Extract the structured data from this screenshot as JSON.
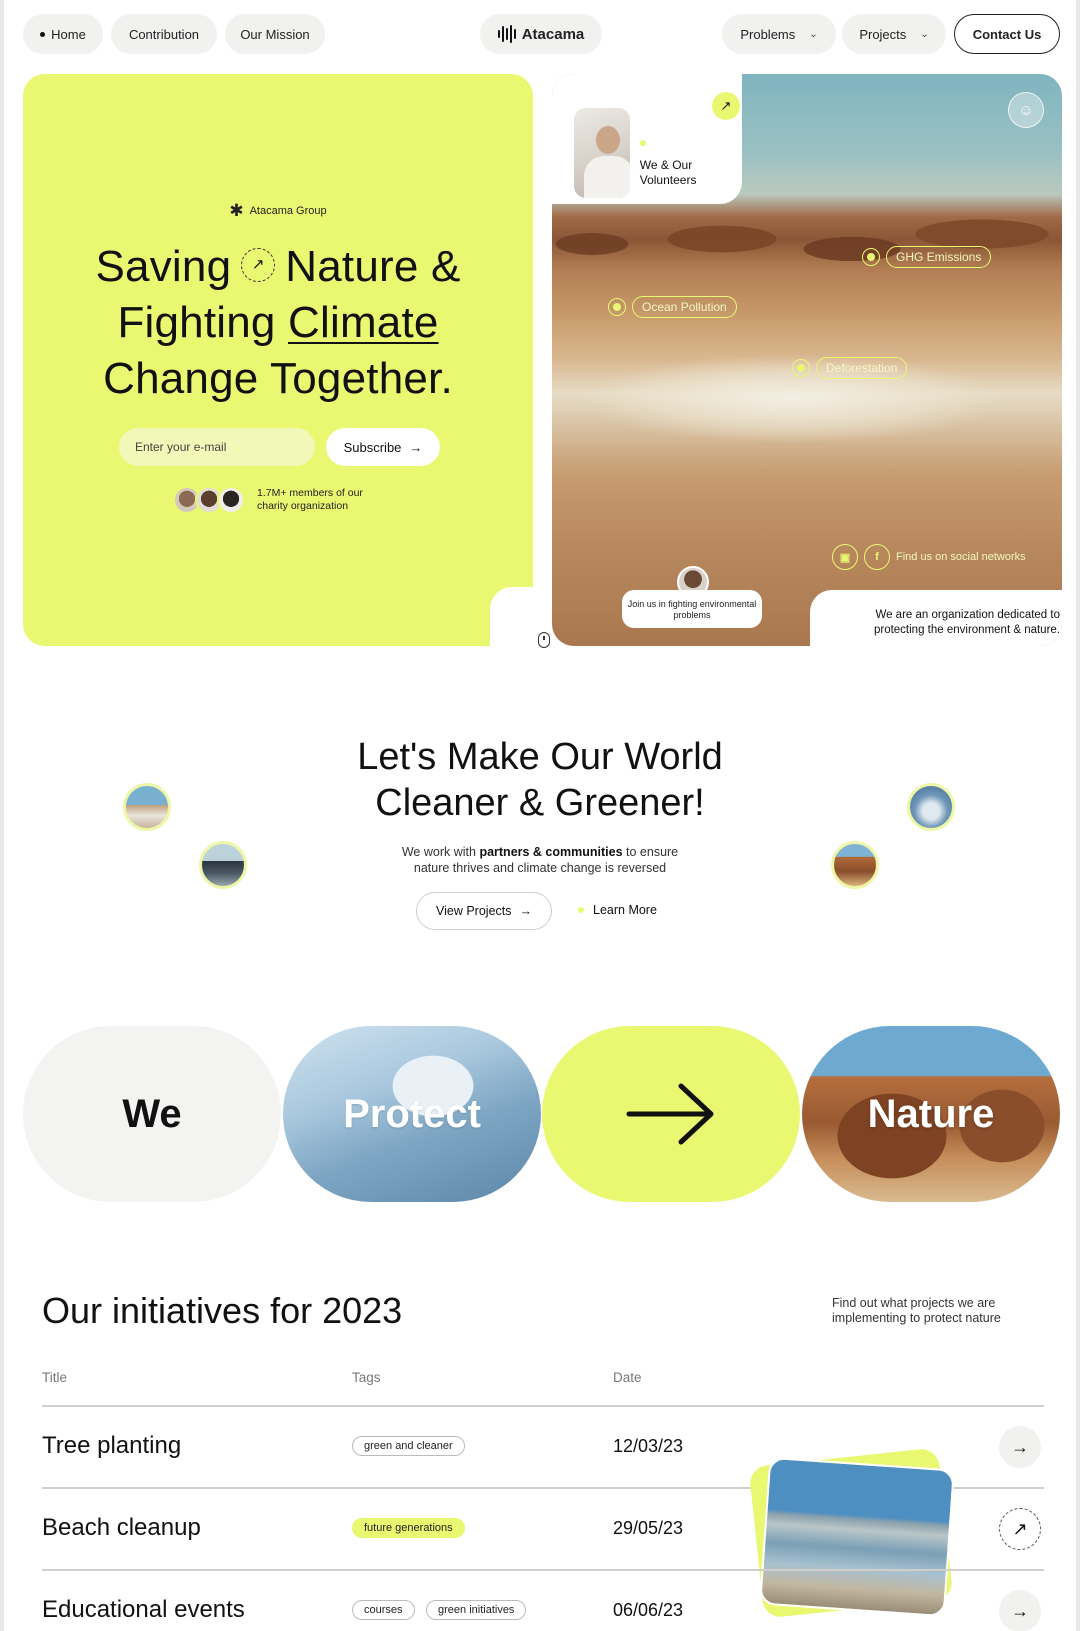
{
  "nav": {
    "home": "Home",
    "contribution": "Contribution",
    "mission": "Our Mission",
    "brand": "Atacama",
    "problems": "Problems",
    "projects": "Projects",
    "contact": "Contact Us"
  },
  "hero": {
    "group": "Atacama Group",
    "title_line1_a": "Saving",
    "title_line1_b": "Nature &",
    "title_line2_a": "Fighting",
    "title_line2_b": "Climate",
    "title_line3": "Change Together.",
    "email_placeholder": "Enter your e-mail",
    "subscribe": "Subscribe",
    "members": "1.7M+ members of our charity organization"
  },
  "photo": {
    "volunteers": "We & Our Volunteers",
    "hotspots": [
      "GHG Emissions",
      "Ocean Pollution",
      "Deforestation"
    ],
    "social": "Find us on social networks",
    "join": "Join us in fighting environmental problems",
    "org": "We are an organization dedicated to protecting the environment & nature."
  },
  "mission": {
    "title_line1": "Let's Make Our World",
    "title_line2": "Cleaner & Greener!",
    "sub_pre": "We work with",
    "sub_bold": "partners & communities",
    "sub_post": "to ensure",
    "sub_line2": "nature thrives and climate change is reversed",
    "view": "View Projects",
    "learn": "Learn More"
  },
  "wpn": {
    "we": "We",
    "protect": "Protect",
    "nature": "Nature"
  },
  "initiatives": {
    "title": "Our initiatives for 2023",
    "note": "Find out what projects we are implementing to protect nature",
    "headers": {
      "title": "Title",
      "tags": "Tags",
      "date": "Date"
    },
    "rows": [
      {
        "title": "Tree planting",
        "tags": [
          "green and cleaner"
        ],
        "date": "12/03/23"
      },
      {
        "title": "Beach cleanup",
        "tags": [
          "future generations"
        ],
        "date": "29/05/23"
      },
      {
        "title": "Educational events",
        "tags": [
          "courses",
          "green initiatives"
        ],
        "date": "06/06/23"
      }
    ]
  },
  "colors": {
    "accent": "#e9f870",
    "text": "#111111"
  },
  "icons": [
    "arrow-right-icon",
    "arrow-up-right-icon",
    "chevron-down-icon",
    "asterisk-icon",
    "mouse-icon",
    "instagram-icon",
    "facebook-icon",
    "person-icon"
  ]
}
